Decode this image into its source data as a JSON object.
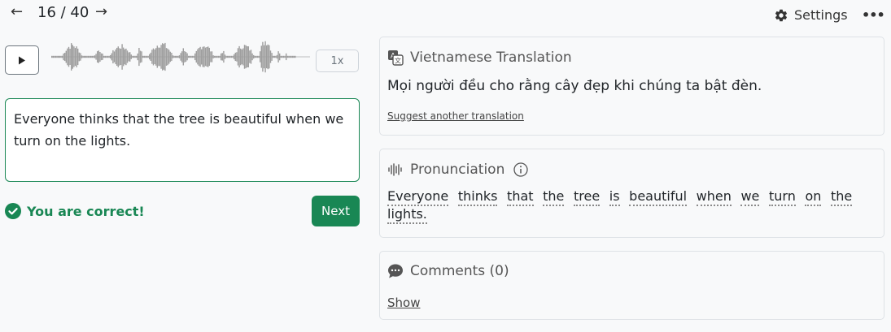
{
  "nav": {
    "prev_glyph": "←",
    "next_glyph": "→",
    "counter": "16 / 40",
    "settings_label": "Settings",
    "more_glyph": "•••"
  },
  "audio": {
    "speed_label": "1x"
  },
  "answer": {
    "text": "Everyone thinks that the tree is beautiful when we turn on the lights."
  },
  "feedback": {
    "correct_label": "You are correct!",
    "next_label": "Next"
  },
  "translation": {
    "heading": "Vietnamese Translation",
    "text": "Mọi người đều cho rằng cây đẹp khi chúng ta bật đèn.",
    "suggest_label": "Suggest another translation"
  },
  "pronunciation": {
    "heading": "Pronunciation",
    "words": [
      "Everyone",
      "thinks",
      "that",
      "the",
      "tree",
      "is",
      "beautiful",
      "when",
      "we",
      "turn",
      "on",
      "the",
      "lights."
    ]
  },
  "comments": {
    "heading": "Comments (0)",
    "show_label": "Show"
  },
  "colors": {
    "success": "#198754",
    "border": "#dee2e6",
    "background": "#f8f9fa"
  }
}
